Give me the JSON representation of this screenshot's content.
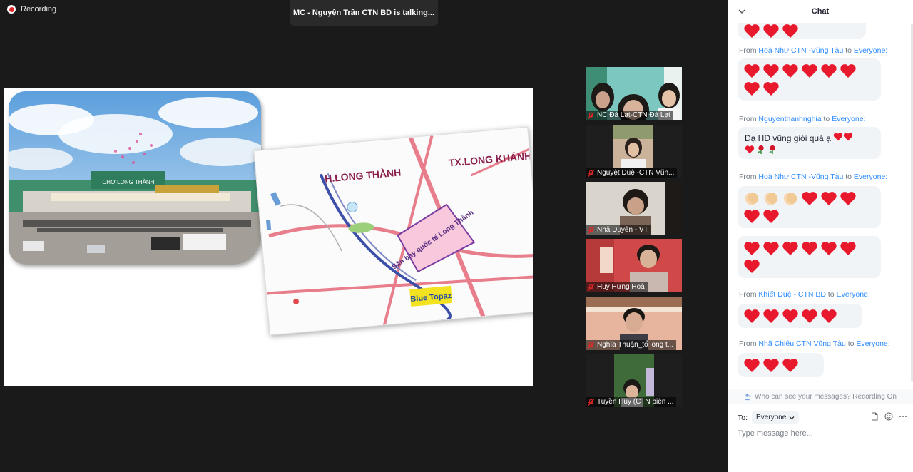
{
  "recording": {
    "label": "Recording"
  },
  "talking": {
    "label": "MC - Nguyện Trần CTN BD is talking..."
  },
  "shared_screen": {
    "market_sign": "CHỢ LONG THÀNH",
    "map": {
      "district": "H.LONG THÀNH",
      "town": "TX.LONG KHÁNH",
      "airport": "Sân bay quốc tế Long Thành",
      "project": "Blue Topaz"
    }
  },
  "participants": [
    {
      "name": "NC Đà Lạt-CTN Đà Lạt",
      "muted": true
    },
    {
      "name": "Nguyệt Duệ -CTN Vũn...",
      "muted": true
    },
    {
      "name": "Nhã Duyên - VT",
      "muted": true
    },
    {
      "name": "Huy Hưng Hoà",
      "muted": true
    },
    {
      "name": "Nghĩa Thuận_tổ long t...",
      "muted": true
    },
    {
      "name": "Tuyền Huy (CTN biên ...",
      "muted": true
    }
  ],
  "chat": {
    "title": "Chat",
    "messages": [
      {
        "from": "",
        "to": "",
        "content": "hearts",
        "hearts": 3
      },
      {
        "from": "Hoà Như CTN -Vũng Tàu",
        "to": "Everyone:",
        "content": "hearts",
        "hearts": 8
      },
      {
        "from": "Nguyenthanhnghia",
        "to": "Everyone:",
        "content": "text",
        "text": "Dạ HĐ vũng giỏi quá ạ"
      },
      {
        "from": "Hoà Như CTN -Vũng Tàu",
        "to": "Everyone:",
        "content": "clap-hearts"
      },
      {
        "from": "",
        "to": "",
        "content": "hearts",
        "hearts": 7
      },
      {
        "from": "Khiết Duệ - CTN BD",
        "to": "Everyone:",
        "content": "hearts",
        "hearts": 5
      },
      {
        "from": "Nhã Chiêu CTN Vũng Tàu",
        "to": "Everyone:",
        "content": "hearts",
        "hearts": 3
      }
    ],
    "from_word": "From",
    "to_word": "to",
    "privacy_note": "Who can see your messages? Recording On",
    "to_label": "To:",
    "recipient": "Everyone",
    "input_placeholder": "Type message here...",
    "colors": {
      "link": "#2d8cff",
      "heart": "#e8192c",
      "bubble": "#f1f4f7"
    }
  }
}
